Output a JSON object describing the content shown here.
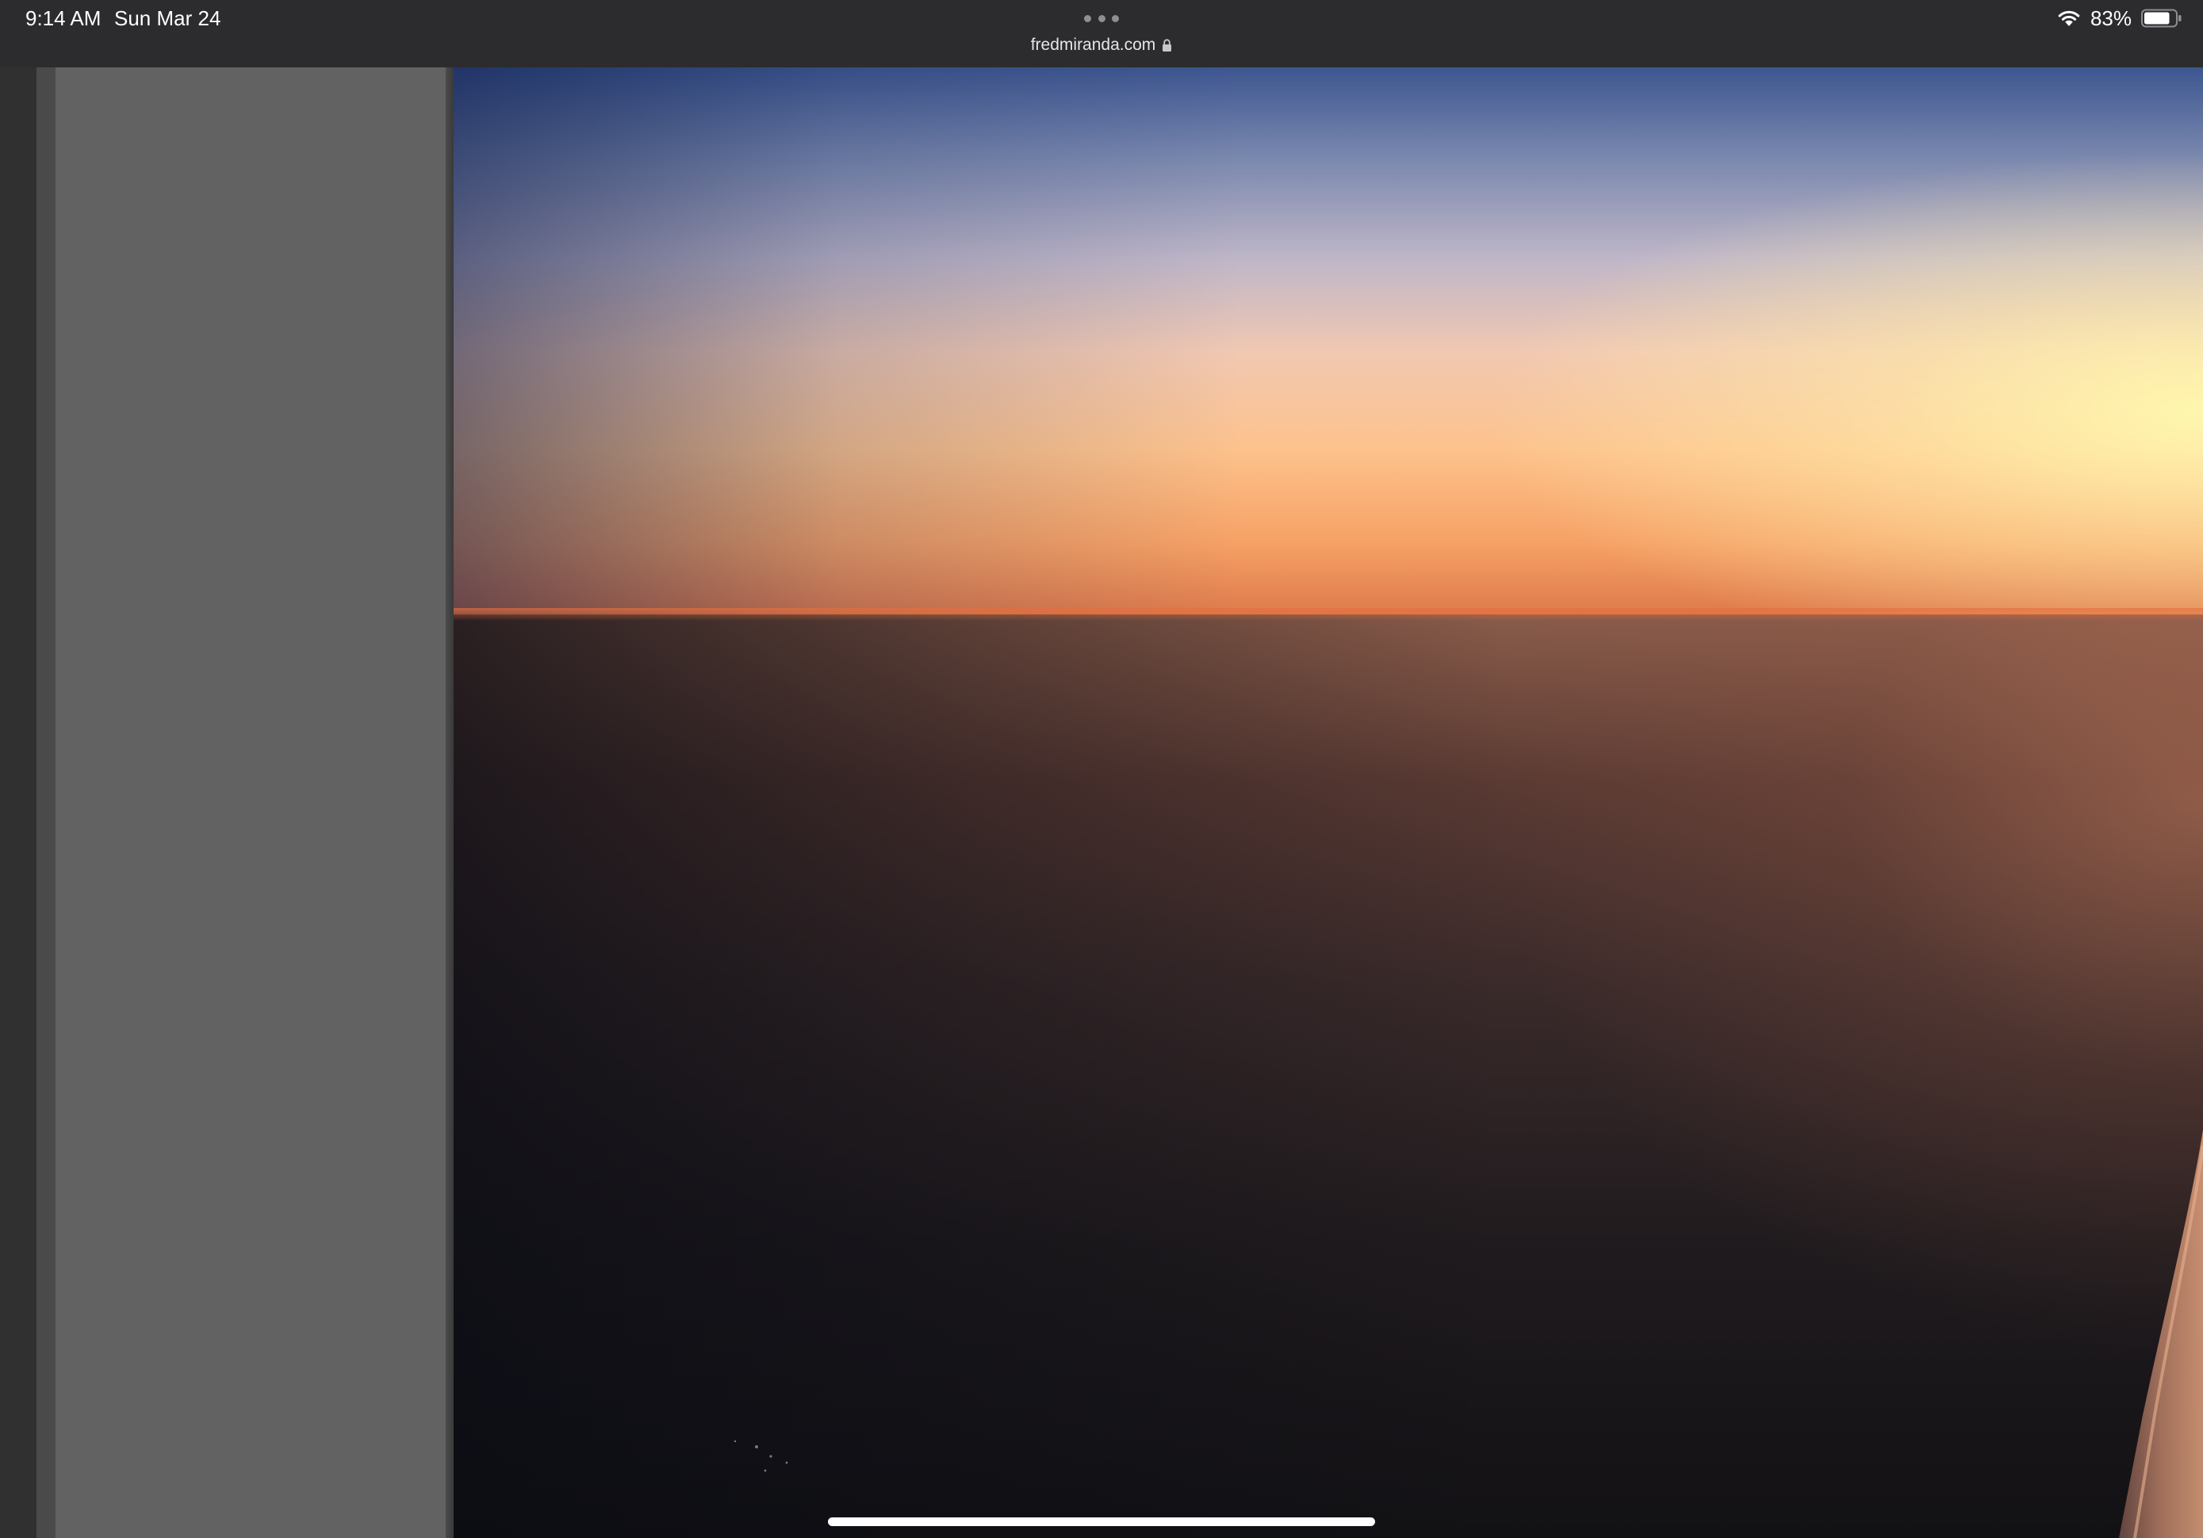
{
  "status_bar": {
    "time": "9:14 AM",
    "date": "Sun Mar 24",
    "battery_percent": "83%",
    "battery_level": 0.83
  },
  "browser": {
    "url": "fredmiranda.com"
  },
  "icons": {
    "wifi": "wifi-icon",
    "battery": "battery-icon",
    "lock": "lock-icon",
    "multitask": "multitask-dots-icon"
  },
  "colors": {
    "chrome_background": "#2c2c2e",
    "sidebar_panel": "#626262",
    "sky_top": "#3d5690",
    "horizon_orange": "#de7a4c",
    "ground_dark": "#121114"
  }
}
